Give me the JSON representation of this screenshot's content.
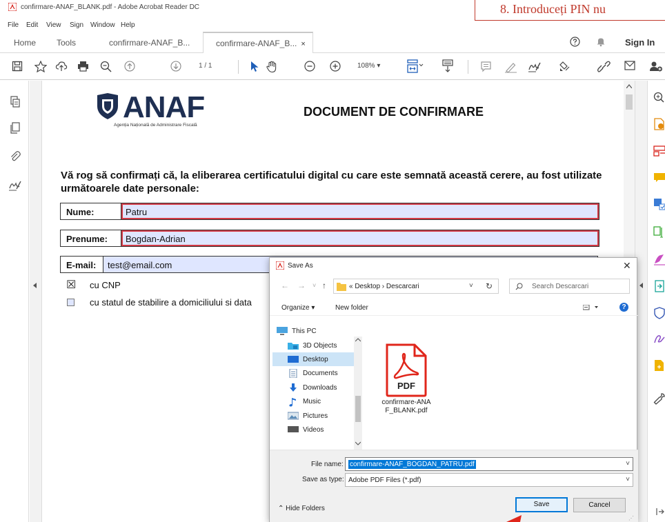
{
  "window": {
    "title": "confirmare-ANAF_BLANK.pdf - Adobe Acrobat Reader DC",
    "banner": "8. Introduceți PIN nu"
  },
  "menu": [
    "File",
    "Edit",
    "View",
    "Sign",
    "Window",
    "Help"
  ],
  "tabs": {
    "home": "Home",
    "tools": "Tools",
    "doc1": "confirmare-ANAF_B...",
    "doc2": "confirmare-ANAF_B...",
    "close_glyph": "×",
    "sign_in": "Sign In"
  },
  "toolbar": {
    "page_indicator": "1  /  1",
    "zoom": "108%  ▾"
  },
  "document": {
    "logo_text": "ANAF",
    "logo_subtitle": "Agenția Națională de Administrare Fiscală",
    "title": "DOCUMENT DE CONFIRMARE",
    "intro": "Vă rog să confirmați că, la eliberarea certificatului digital cu care este semnată această cerere, au fost utilizate următoarele date personale:",
    "fields": [
      {
        "label": "Nume:",
        "value": "Patru"
      },
      {
        "label": "Prenume:",
        "value": "Bogdan-Adrian"
      },
      {
        "label": "E-mail:",
        "value": "test@email.com"
      }
    ],
    "checkboxes": [
      {
        "label": "cu CNP",
        "checked": true
      },
      {
        "label": "cu statul de stabilire a domiciliului si data",
        "checked": false
      }
    ],
    "checked_glyph": "☒"
  },
  "dialog": {
    "title": "Save As",
    "close_glyph": "✕",
    "nav": {
      "back": "←",
      "forward": "→",
      "down": "˅",
      "up": "↑"
    },
    "address": "«  Desktop  ›  Descarcari",
    "address_dropdown": "˅",
    "refresh": "↻",
    "search_placeholder": "Search Descarcari",
    "organize": "Organize ▾",
    "new_folder": "New folder",
    "help_glyph": "?",
    "tree": [
      "This PC",
      "3D Objects",
      "Desktop",
      "Documents",
      "Downloads",
      "Music",
      "Pictures",
      "Videos"
    ],
    "selected_tree_item": "Desktop",
    "file_item": "confirmare-ANAF_BLANK.pdf",
    "file_item_line1": "confirmare-ANA",
    "file_item_line2": "F_BLANK.pdf",
    "pdf_badge": "PDF",
    "file_name_label": "File name:",
    "file_name_value": "confirmare-ANAF_BOGDAN_PATRU.pdf",
    "dropdown_glyph": "˅",
    "save_as_type_label": "Save as type:",
    "save_as_type_value": "Adobe PDF Files (*.pdf)",
    "hide_folders": "⌃  Hide Folders",
    "save_button": "Save",
    "cancel_button": "Cancel",
    "grip": "⋰"
  },
  "colors": {
    "field_fill": "#dfe6ff",
    "field_highlight": "#d33a45",
    "anaf_navy": "#1e2f52",
    "pdf_red": "#e0261b",
    "selection_blue": "#0078d7",
    "banner_red": "#c0392b"
  },
  "icons": {
    "left_panel": [
      "page-thumbnails-icon",
      "copy-pages-icon",
      "attachment-icon",
      "fill-sign-icon"
    ],
    "right_panel": [
      "zoom-icon",
      "export-pdf-icon",
      "organize-pages-icon",
      "comment-icon",
      "scan-icon",
      "edit-pdf-icon",
      "fill-sign-icon",
      "send-icon",
      "protect-icon",
      "sign-icon",
      "create-pdf-icon",
      "tools-icon"
    ]
  }
}
